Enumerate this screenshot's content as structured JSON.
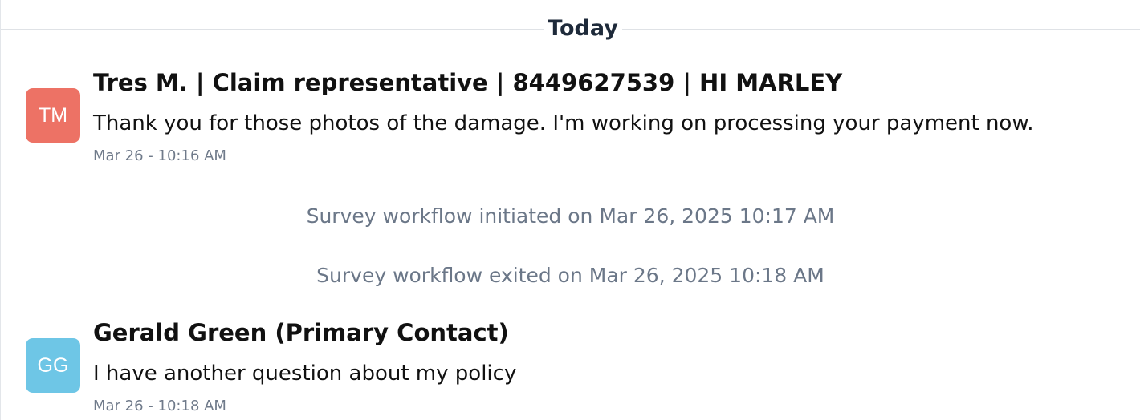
{
  "divider": {
    "label": "Today"
  },
  "messages": [
    {
      "initials": "TM",
      "avatar_color": "#ed7265",
      "sender": "Tres M. | Claim representative | 8449627539 | HI MARLEY",
      "text": "Thank you for those photos of the damage. I'm working on processing your payment now.",
      "timestamp": "Mar 26 - 10:16 AM"
    },
    {
      "initials": "GG",
      "avatar_color": "#6ec6e6",
      "sender": "Gerald Green (Primary Contact)",
      "text": "I have another question about my policy",
      "timestamp": "Mar 26 - 10:18 AM"
    }
  ],
  "system_events": [
    "Survey workflow initiated on Mar 26, 2025 10:17 AM",
    "Survey workflow exited on Mar 26, 2025 10:18 AM"
  ]
}
